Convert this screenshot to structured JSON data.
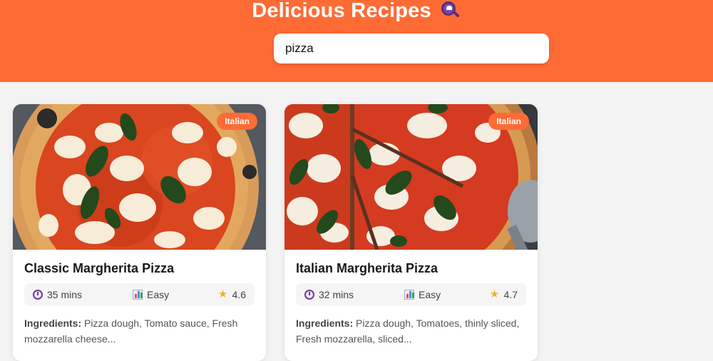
{
  "header": {
    "title": "Delicious Recipes",
    "title_icon": "magnifier-emoji-icon",
    "brand_color": "#ff6b35"
  },
  "search": {
    "value": "pizza",
    "placeholder": ""
  },
  "recipes": [
    {
      "name": "Classic Margherita Pizza",
      "cuisine": "Italian",
      "time": "35 mins",
      "difficulty": "Easy",
      "rating": "4.6",
      "ingredients_label": "Ingredients:",
      "ingredients_line1": "Pizza dough, Tomato sauce, Fresh",
      "ingredients_line2": "mozzarella cheese..."
    },
    {
      "name": "Italian Margherita Pizza",
      "cuisine": "Italian",
      "time": "32 mins",
      "difficulty": "Easy",
      "rating": "4.7",
      "ingredients_label": "Ingredients:",
      "ingredients_line1": "Pizza dough, Tomatoes, thinly sliced,",
      "ingredients_line2": "Fresh mozzarella, sliced..."
    }
  ],
  "icons": {
    "time": "stopwatch-icon",
    "difficulty": "bar-chart-icon",
    "rating": "star-icon"
  }
}
